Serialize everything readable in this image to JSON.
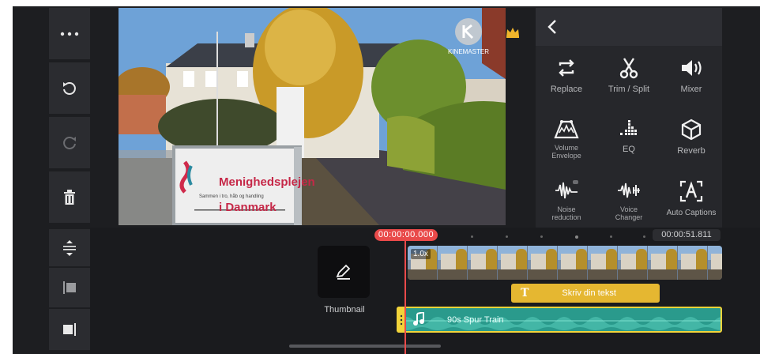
{
  "left_toolbar": {
    "items": [
      {
        "name": "more-icon",
        "glyph": "⋯"
      },
      {
        "name": "undo-icon",
        "glyph": "↶"
      },
      {
        "name": "redo-icon",
        "glyph": "↷"
      },
      {
        "name": "trash-icon",
        "glyph": "🗑"
      }
    ]
  },
  "preview": {
    "watermark": "KINEMASTER",
    "sign_title": "Menighedsplejen\ni Danmark",
    "sign_line1": "Menighedsplejen",
    "sign_line2": "i Danmark",
    "sign_subtitle": "Sammen i tro, håb og handling"
  },
  "right_panel": {
    "back_icon": "chevron-left-icon",
    "tools": [
      {
        "label": "Replace",
        "icon": "replace-icon"
      },
      {
        "label": "Trim / Split",
        "icon": "scissors-icon"
      },
      {
        "label": "Mixer",
        "icon": "speaker-icon"
      },
      {
        "label": "Volume\nEnvelope",
        "label_line1": "Volume",
        "label_line2": "Envelope",
        "icon": "volume-envelope-icon"
      },
      {
        "label": "EQ",
        "icon": "eq-icon"
      },
      {
        "label": "Reverb",
        "icon": "reverb-cube-icon"
      },
      {
        "label": "Noise\nreduction",
        "label_line1": "Noise",
        "label_line2": "reduction",
        "icon": "noise-reduction-icon"
      },
      {
        "label": "Voice\nChanger",
        "label_line1": "Voice",
        "label_line2": "Changer",
        "icon": "voice-changer-icon"
      },
      {
        "label": "Auto Captions",
        "icon": "auto-captions-icon"
      }
    ]
  },
  "timeline": {
    "current_time": "00:00:00.000",
    "total_time": "00:00:51.811",
    "thumbnail_label": "Thumbnail",
    "video_clip_speed": "1.0x",
    "text_clip_label": "Skriv din tekst",
    "audio_clip_label": "90s Spur Train"
  },
  "colors": {
    "background": "#1d1e21",
    "accent_red": "#e94a4a",
    "text_clip": "#e5b731",
    "audio_clip": "#2a9a8c",
    "audio_border": "#f2d43a"
  }
}
